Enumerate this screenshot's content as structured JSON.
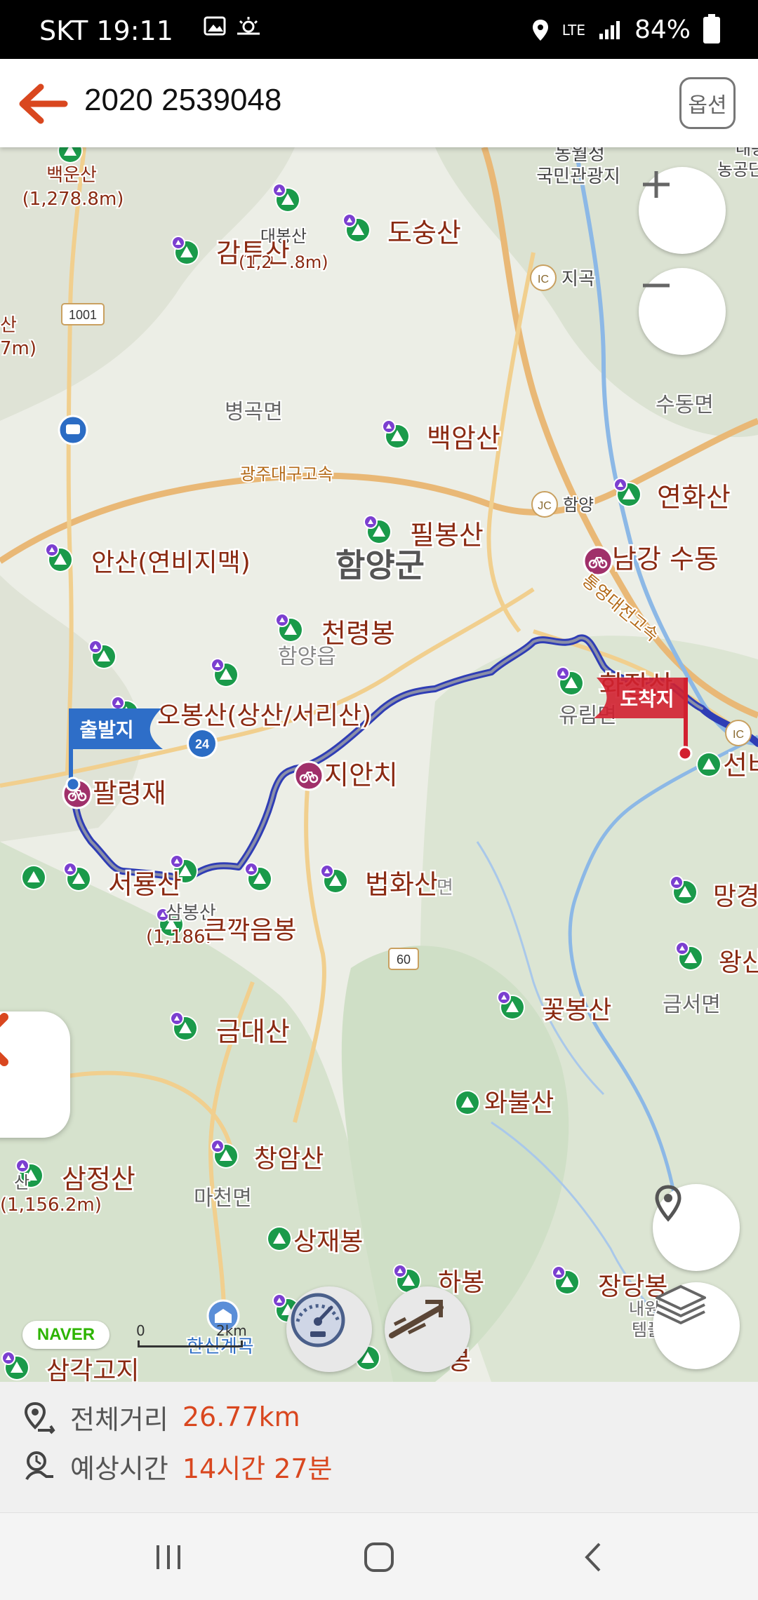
{
  "status_bar": {
    "carrier": "SKT 19:11",
    "network": "LTE",
    "battery": "84%"
  },
  "app_bar": {
    "title": "2020 2539048",
    "options_label": "옵션"
  },
  "map": {
    "labels": {
      "baekunsan": "백운산",
      "baekunsan_elev": "(1,278.8m)",
      "gamtusan": "감투산",
      "daebongsan": "대봉산",
      "daebongsan_elev": "(1,2",
      "daebongsan_elev2": ".8m)",
      "dosungsan": "도숭산",
      "park1": "농월정",
      "park2": "국민관광지",
      "park3": "농공단",
      "park4": "대봉산",
      "left_san": "산",
      "left_elev": "7m)",
      "ic_jigok": "지곡",
      "ic_tag": "IC",
      "road_1001": "1001",
      "byeonggok": "병곡면",
      "sudong": "수동면",
      "baekamsan": "백암산",
      "highway": "광주대구고속",
      "jc_tag": "JC",
      "jc_hamyang": "함양",
      "yeonhwasan": "연화산",
      "pilbongsan": "필봉산",
      "hamyanggun": "함양군",
      "namgang": "남강 수동",
      "ansan": "안산(연비지맥)",
      "tongyeong": "통영대전고속",
      "cheonryeongbong": "천령봉",
      "hamyangeup": "함양읍",
      "hwajangsan": "화장산",
      "yurim": "유림면",
      "obongsan": "오봉산(상산/서리산)",
      "route_24": "24",
      "jianchi": "지안치",
      "palryeongjae": "팔령재",
      "seonbi": "선비",
      "seoryongsan": "서룡산",
      "sambongsan": "삼봉산",
      "sambongsan_elev": "(1,186.",
      "keunkkageumbong": "큰깍음봉",
      "beophwasan": "법화산",
      "myeon_suffix": "면",
      "manggyeong": "망경",
      "wangsan": "왕산",
      "road_60": "60",
      "kkotbongsan": "꽃봉산",
      "geumseo": "금서면",
      "geumdaesan": "금대산",
      "wabulsan": "와불산",
      "changamsan": "창암산",
      "samjeongsan": "삼정산",
      "samjeong_elev": "(1,156.2m)",
      "samjeong_prefix": "산",
      "macheon": "마천면",
      "sangjaebong": "상재봉",
      "habong": "하봉",
      "jangdangbong": "장당봉",
      "naewon": "내원",
      "temple": "템플",
      "hansin": "한신계곡",
      "samgakgoji": "삼각고지",
      "bong_bottom": "봉"
    },
    "start_flag": "출발지",
    "end_flag": "도착지",
    "naver_badge": "NAVER",
    "scale_zero": "0",
    "scale_km": "2km",
    "colors": {
      "route": "#2f3db5",
      "route_inner": "#8a8fa8",
      "peak_label": "#8a2a12",
      "start_flag": "#2e6ec8",
      "end_flag": "#d22030",
      "accent": "#d9471f"
    }
  },
  "info": {
    "distance_label": "전체거리",
    "distance_value": "26.77km",
    "time_label": "예상시간",
    "time_value": "14시간 27분"
  },
  "nav_bar": {
    "recent": "recent-apps-icon",
    "home": "home-icon",
    "back": "back-icon"
  }
}
